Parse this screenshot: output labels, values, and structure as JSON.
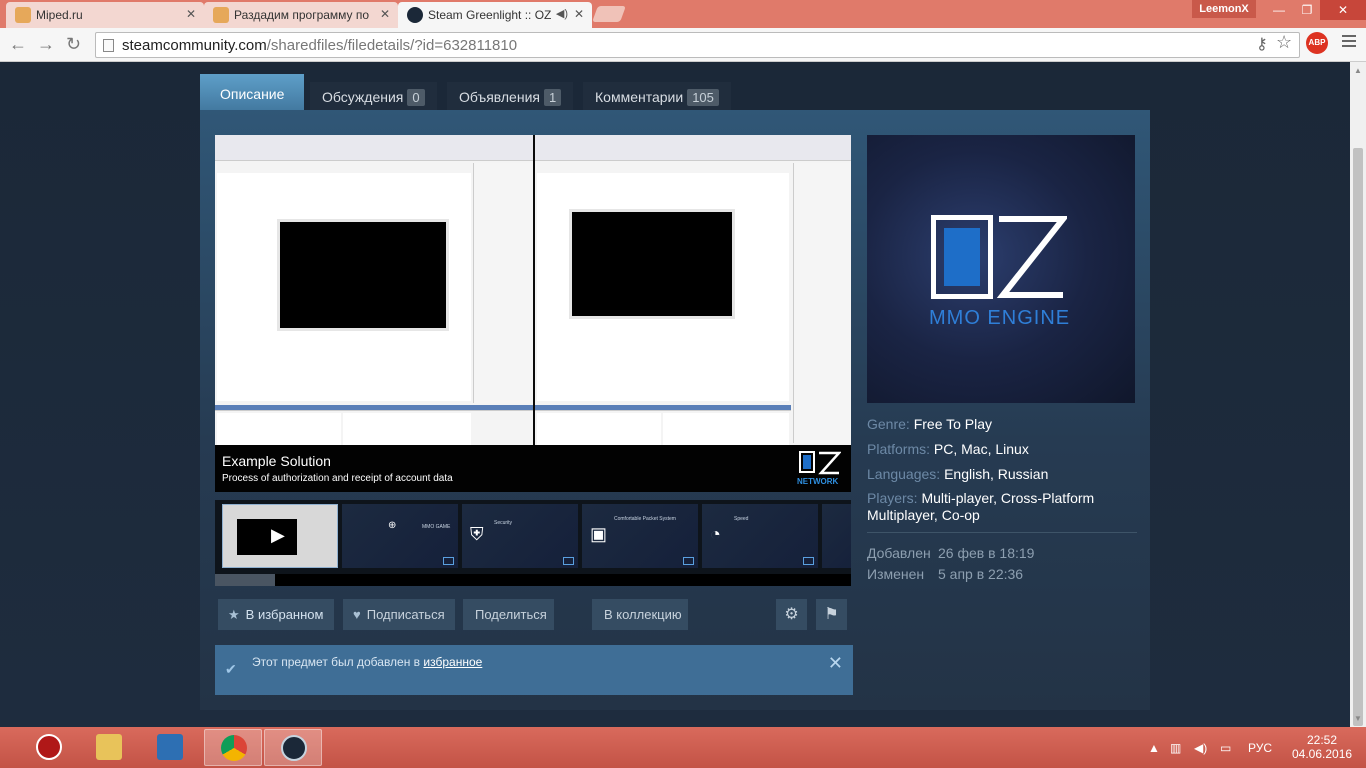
{
  "browser": {
    "tabs": [
      {
        "label": "Miped.ru",
        "active": false
      },
      {
        "label": "Раздадим программу по",
        "active": false
      },
      {
        "label": "Steam Greenlight :: OZ",
        "active": true
      }
    ],
    "user": "LeemonX",
    "window_controls": [
      "—",
      "❐",
      "✕"
    ],
    "url_host": "steamcommunity.com",
    "url_path": "/sharedfiles/filedetails/?id=632811810",
    "abp_label": "ABP"
  },
  "page": {
    "tabs": [
      {
        "label": "Описание",
        "count": null
      },
      {
        "label": "Обсуждения",
        "count": "0"
      },
      {
        "label": "Объявления",
        "count": "1"
      },
      {
        "label": "Комментарии",
        "count": "105"
      }
    ],
    "viewer": {
      "caption_title": "Example Solution",
      "caption_sub": "Process of authorization and receipt of account data",
      "logo_text": "NETWORK"
    },
    "thumbnails": [
      {
        "label": "",
        "icon": "play-icon"
      },
      {
        "label": "MMO GAME",
        "icon": "network-icon"
      },
      {
        "label": "Security",
        "icon": "shield-icon"
      },
      {
        "label": "Comfortable Packet System",
        "icon": "packet-icon"
      },
      {
        "label": "Speed",
        "icon": "speedometer-icon"
      }
    ],
    "actions": {
      "favorite": "В избранном",
      "subscribe": "Подписаться",
      "share": "Поделиться",
      "collection": "В коллекцию"
    },
    "notice": {
      "text": "Этот предмет был добавлен в ",
      "link": "избранное"
    },
    "capsule": {
      "engine": "MMO ENGINE"
    },
    "details": {
      "genre_key": "Genre:",
      "genre": "Free To Play",
      "platforms_key": "Platforms:",
      "platforms": [
        "PC",
        "Mac",
        "Linux"
      ],
      "languages_key": "Languages:",
      "languages": [
        "English",
        "Russian"
      ],
      "players_key": "Players:",
      "players_1": "Multi-player",
      "players_2": "Cross-Platform Multiplayer",
      "players_3": "Co-op",
      "added_key": "Добавлен",
      "added": "26 фев в 18:19",
      "updated_key": "Изменен",
      "updated": "5 апр в 22:36"
    }
  },
  "taskbar": {
    "apps": [
      "power-app",
      "file-explorer",
      "control-app",
      "chrome",
      "steam"
    ],
    "lang": "РУС",
    "time": "22:52",
    "date": "04.06.2016"
  },
  "colors": {
    "steam_bg": "#1b2838",
    "accent_blue": "#5e9fc9",
    "taskbar": "#c35346"
  }
}
